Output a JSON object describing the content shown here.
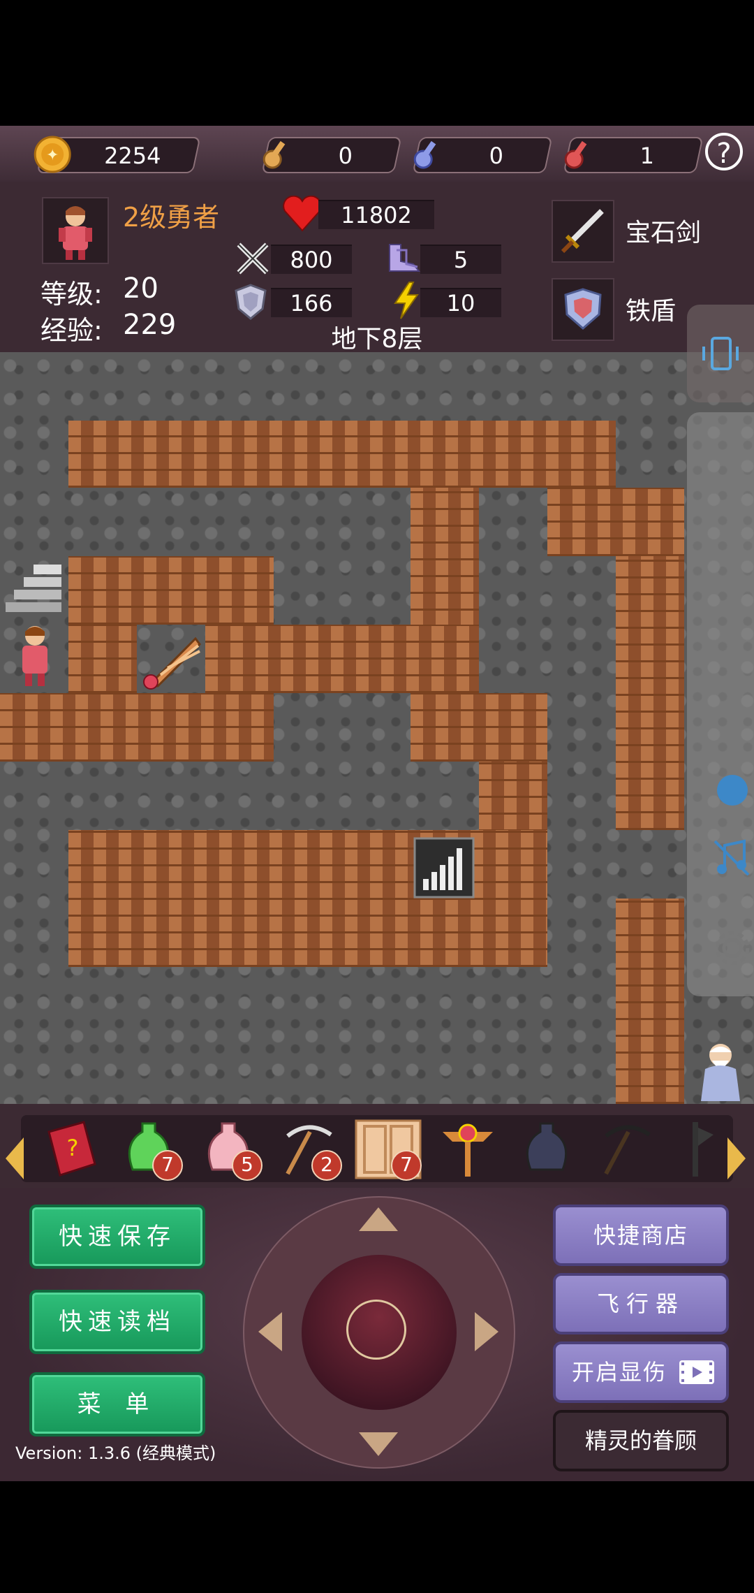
{
  "resources": {
    "gold": "2254",
    "yellow_keys": "0",
    "blue_keys": "0",
    "red_keys": "1",
    "help_label": "?"
  },
  "hero": {
    "title": "2级勇者",
    "level_label": "等级:",
    "level": "20",
    "exp_label": "经验:",
    "exp": "229",
    "hp": "11802",
    "attack": "800",
    "defense": "166",
    "agility": "5",
    "magic": "10"
  },
  "equipment": {
    "weapon": "宝石剑",
    "shield": "铁盾"
  },
  "floor": "地下8层",
  "items": [
    {
      "name": "monster-book",
      "count": ""
    },
    {
      "name": "green-potion",
      "count": "7"
    },
    {
      "name": "pink-potion",
      "count": "5"
    },
    {
      "name": "pickaxe",
      "count": "2"
    },
    {
      "name": "door-scroll",
      "count": "7"
    },
    {
      "name": "golden-wand",
      "count": ""
    },
    {
      "name": "dark-vase",
      "count": ""
    },
    {
      "name": "dark-pickaxe",
      "count": ""
    }
  ],
  "buttons": {
    "quick_save": "快速保存",
    "quick_load": "快速读档",
    "menu": "菜 单",
    "quick_shop": "快捷商店",
    "flyer": "飞行器",
    "show_damage": "开启显伤",
    "fairy_favor": "精灵的眷顾"
  },
  "version": "Version: 1.3.6 (经典模式)",
  "colors": {
    "accent_gold": "#e9b94b",
    "hero_title": "#f0a046",
    "green_button": "#1ea866",
    "purple_button": "#8b80c4"
  }
}
